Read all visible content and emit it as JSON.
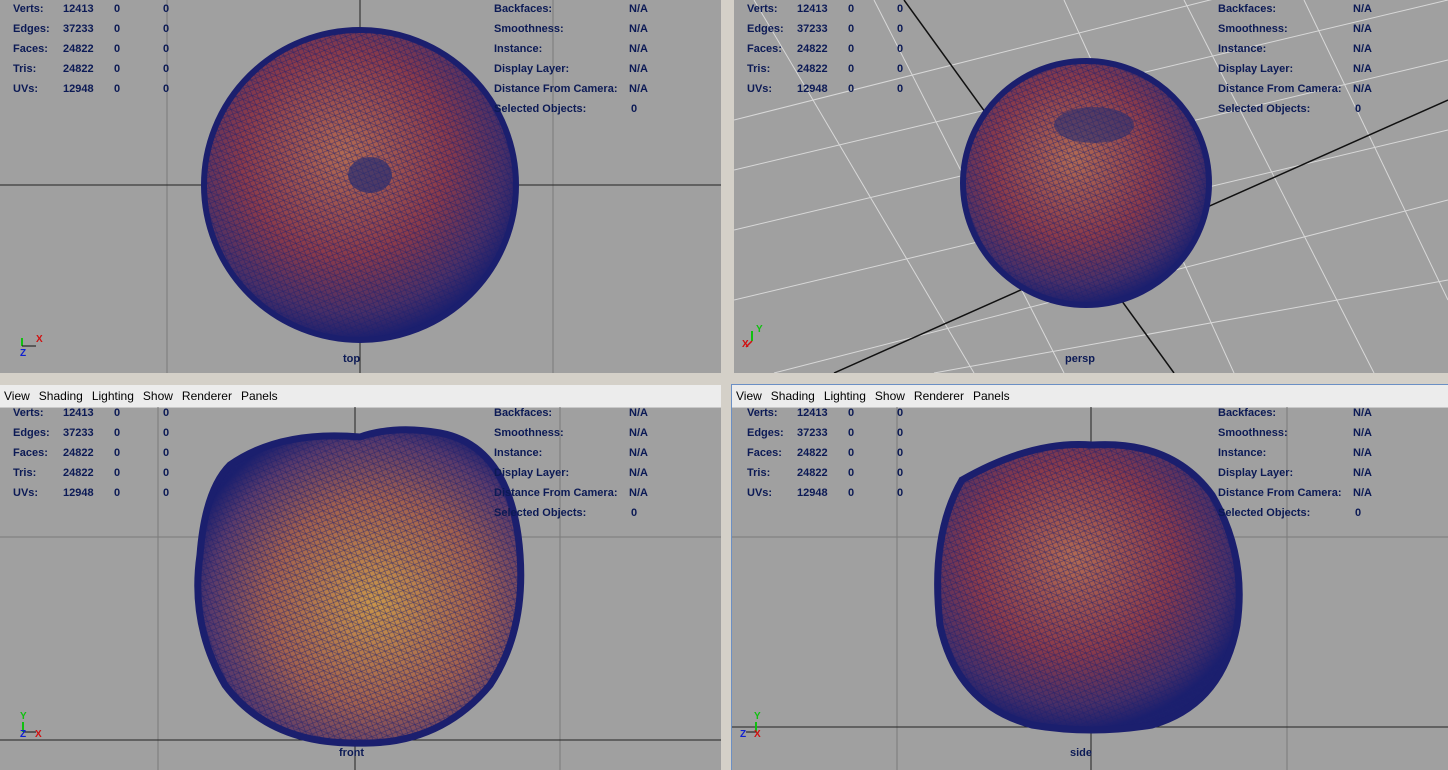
{
  "menu": [
    "View",
    "Shading",
    "Lighting",
    "Show",
    "Renderer",
    "Panels"
  ],
  "hud_stats": [
    {
      "label": "Verts:",
      "v1": "12413",
      "v2": "0",
      "v3": "0"
    },
    {
      "label": "Edges:",
      "v1": "37233",
      "v2": "0",
      "v3": "0"
    },
    {
      "label": "Faces:",
      "v1": "24822",
      "v2": "0",
      "v3": "0"
    },
    {
      "label": "Tris:",
      "v1": "24822",
      "v2": "0",
      "v3": "0"
    },
    {
      "label": "UVs:",
      "v1": "12948",
      "v2": "0",
      "v3": "0"
    }
  ],
  "hud_info": [
    {
      "label": "Backfaces:",
      "value": "N/A"
    },
    {
      "label": "Smoothness:",
      "value": "N/A"
    },
    {
      "label": "Instance:",
      "value": "N/A"
    },
    {
      "label": "Display Layer:",
      "value": "N/A"
    },
    {
      "label": "Distance From Camera:",
      "value": "N/A"
    },
    {
      "label": "Selected Objects:",
      "value": "0"
    }
  ],
  "viewports": [
    {
      "camera": "top",
      "axis_a": "X",
      "axis_b": "Z"
    },
    {
      "camera": "persp",
      "axis_a": "Y",
      "axis_b": "X"
    },
    {
      "camera": "front",
      "axis_a": "Y",
      "axis_b": "X"
    },
    {
      "camera": "side",
      "axis_a": "Y",
      "axis_b": "Z"
    }
  ],
  "colors": {
    "viewport_bg": "#a0a0a0",
    "hud_text": "#0c1a55",
    "wire": "#1b1f6e",
    "flesh_warm": "#c9954a",
    "flesh_red": "#8a3a4a",
    "axis_x": "#d01010",
    "axis_y": "#10c010",
    "axis_z": "#1020d0"
  }
}
